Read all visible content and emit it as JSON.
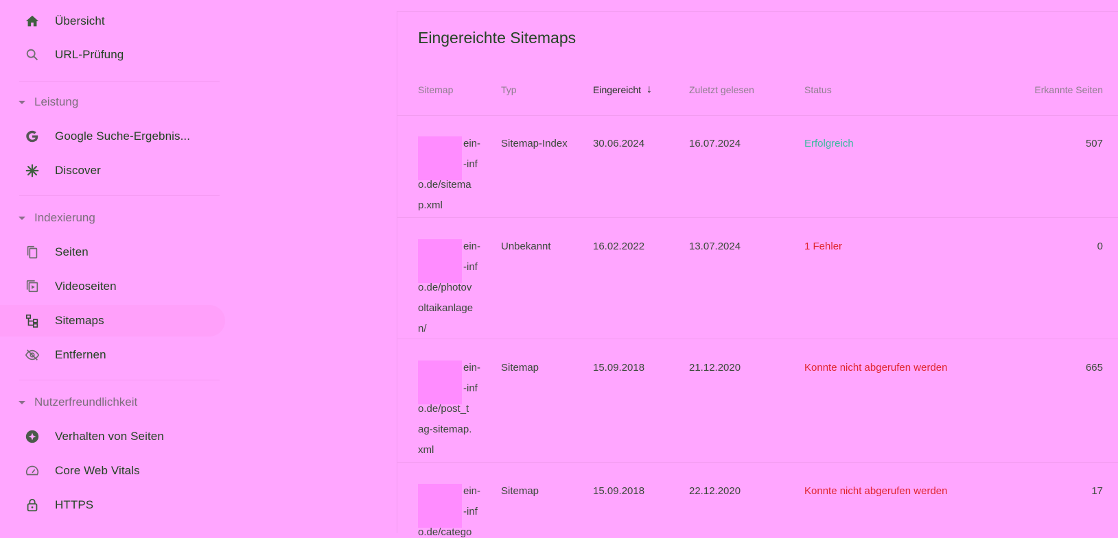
{
  "sidebar": {
    "top_items": [
      {
        "label": "Übersicht",
        "icon": "home-icon"
      },
      {
        "label": "URL-Prüfung",
        "icon": "search-icon"
      }
    ],
    "sections": [
      {
        "label": "Leistung",
        "items": [
          {
            "label": "Google Suche-Ergebnis...",
            "icon": "google-g-icon"
          },
          {
            "label": "Discover",
            "icon": "asterisk-icon"
          }
        ]
      },
      {
        "label": "Indexierung",
        "items": [
          {
            "label": "Seiten",
            "icon": "pages-icon"
          },
          {
            "label": "Videoseiten",
            "icon": "video-pages-icon"
          },
          {
            "label": "Sitemaps",
            "icon": "sitemap-icon",
            "active": true
          },
          {
            "label": "Entfernen",
            "icon": "eye-off-icon"
          }
        ]
      },
      {
        "label": "Nutzerfreundlichkeit",
        "items": [
          {
            "label": "Verhalten von Seiten",
            "icon": "star-badge-icon"
          },
          {
            "label": "Core Web Vitals",
            "icon": "gauge-icon"
          },
          {
            "label": "HTTPS",
            "icon": "lock-icon"
          }
        ]
      }
    ]
  },
  "main": {
    "title": "Eingereichte Sitemaps",
    "columns": {
      "sitemap": "Sitemap",
      "type": "Typ",
      "submitted": "Eingereicht",
      "last_read": "Zuletzt gelesen",
      "status": "Status",
      "pages": "Erkannte Seiten"
    },
    "rows": [
      {
        "url": "ein-\n-inf\no.de/sitema\np.xml",
        "url_lines": [
          "ein-",
          "-inf",
          "o.de/sitema",
          "p.xml"
        ],
        "type": "Sitemap-Index",
        "submitted": "30.06.2024",
        "last_read": "16.07.2024",
        "status": "Erfolgreich",
        "status_color": "#3dbaa0",
        "pages": "507"
      },
      {
        "url_lines": [
          "ein-",
          "-inf",
          "o.de/photov",
          "oltaikanlage",
          "n/"
        ],
        "type": "Unbekannt",
        "submitted": "16.02.2022",
        "last_read": "13.07.2024",
        "status": "1 Fehler",
        "status_color": "#e0252f",
        "pages": "0"
      },
      {
        "url_lines": [
          "ein-",
          "-inf",
          "o.de/post_t",
          "ag-sitemap.",
          "xml"
        ],
        "type": "Sitemap",
        "submitted": "15.09.2018",
        "last_read": "21.12.2020",
        "status": "Konnte nicht abgerufen werden",
        "status_color": "#e0252f",
        "pages": "665"
      },
      {
        "url_lines": [
          "ein-",
          "-inf",
          "o.de/catego"
        ],
        "type": "Sitemap",
        "submitted": "15.09.2018",
        "last_read": "22.12.2020",
        "status": "Konnte nicht abgerufen werden",
        "status_color": "#e0252f",
        "pages": "17"
      }
    ]
  },
  "colors": {
    "background": "#FFA6FF",
    "success": "#3dbaa0",
    "error": "#e0252f"
  }
}
